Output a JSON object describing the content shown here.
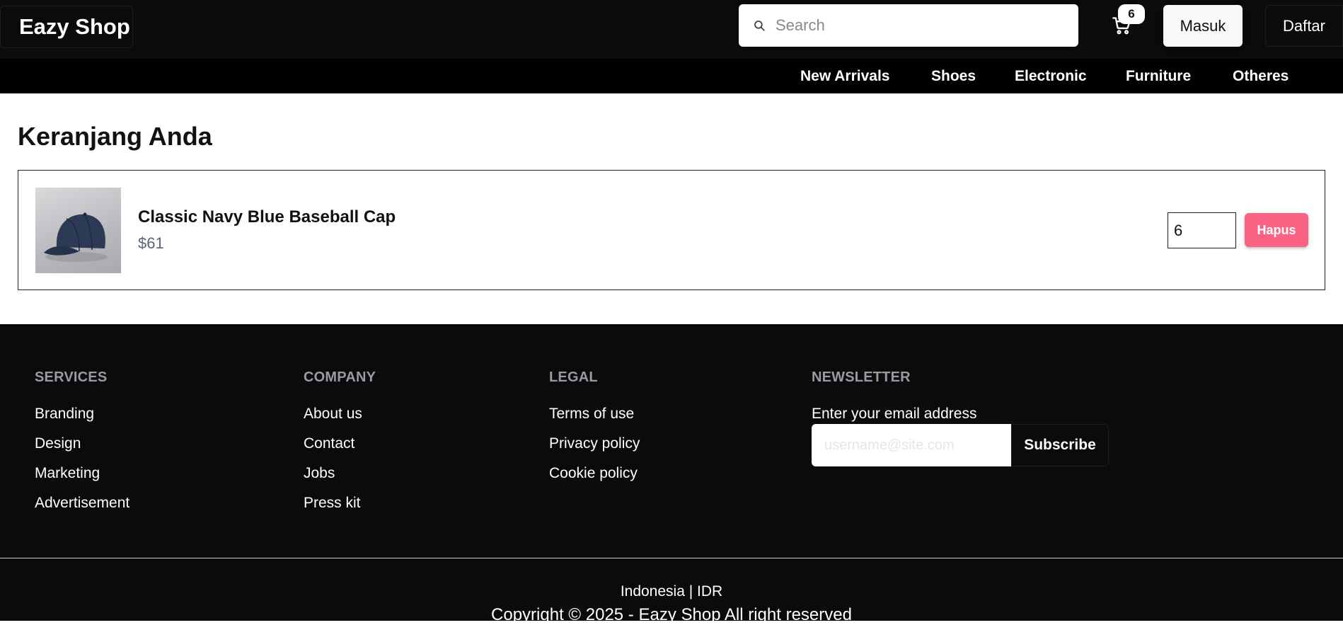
{
  "header": {
    "brand": "Eazy Shop",
    "search_placeholder": "Search",
    "cart_count": "6",
    "login_label": "Masuk",
    "register_label": "Daftar"
  },
  "categories": [
    "New Arrivals",
    "Shoes",
    "Electronic",
    "Furniture",
    "Otheres"
  ],
  "cart": {
    "title": "Keranjang Anda",
    "items": [
      {
        "name": "Classic Navy Blue Baseball Cap",
        "price": "$61",
        "quantity": "6",
        "remove_label": "Hapus"
      }
    ]
  },
  "footer": {
    "services": {
      "heading": "SERVICES",
      "links": [
        "Branding",
        "Design",
        "Marketing",
        "Advertisement"
      ]
    },
    "company": {
      "heading": "COMPANY",
      "links": [
        "About us",
        "Contact",
        "Jobs",
        "Press kit"
      ]
    },
    "legal": {
      "heading": "LEGAL",
      "links": [
        "Terms of use",
        "Privacy policy",
        "Cookie policy"
      ]
    },
    "newsletter": {
      "heading": "NEWSLETTER",
      "label": "Enter your email address",
      "placeholder": "username@site.com",
      "button": "Subscribe"
    },
    "locale": "Indonesia | IDR",
    "copyright": "Copyright © 2025 - Eazy Shop All right reserved"
  },
  "colors": {
    "header_bg": "#0b0b0e",
    "nav_bg": "#000000",
    "remove_button": "#fb6385",
    "price_text": "#5b6477"
  }
}
